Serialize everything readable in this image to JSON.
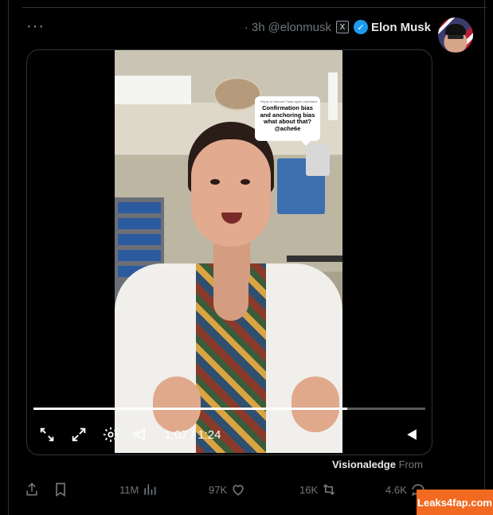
{
  "post": {
    "author_name": "Elon Musk",
    "handle": "@elonmusk",
    "time": "· 3h",
    "more": "···"
  },
  "video": {
    "bubble_small": "Reply to Harvard Trade apple submitted",
    "bubble_text": "Confirmation bias and anchoring bias what about that? @ache6e",
    "time_readout": "1:07 / 1:24",
    "progress_fraction": 0.8
  },
  "source": {
    "prefix": "From",
    "name": "Visionaledge"
  },
  "actions": {
    "replies": "4.6K",
    "reposts": "16K",
    "likes": "97K",
    "views": "11M"
  },
  "watermark": "Leaks4fap.com",
  "colors": {
    "background": "#000000",
    "verified": "#1d9bf0",
    "secondary_text": "#71767b",
    "watermark": "#f26a21"
  }
}
